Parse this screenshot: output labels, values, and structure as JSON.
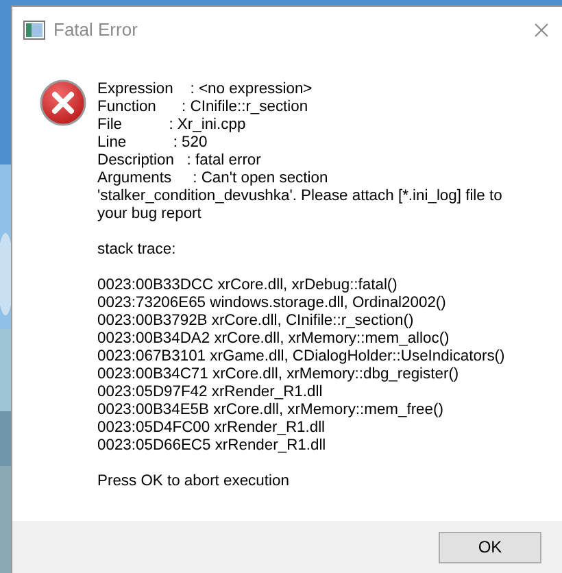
{
  "window": {
    "title": "Fatal Error"
  },
  "details": [
    "Expression    : <no expression>",
    "Function      : CInifile::r_section",
    "File           : Xr_ini.cpp",
    "Line           : 520",
    "Description   : fatal error",
    "Arguments     : Can't open section",
    "'stalker_condition_devushka'. Please attach [*.ini_log] file to",
    "your bug report"
  ],
  "stack_trace_heading": "stack trace:",
  "stack_trace": [
    "0023:00B33DCC xrCore.dll, xrDebug::fatal()",
    "0023:73206E65 windows.storage.dll, Ordinal2002()",
    "0023:00B3792B xrCore.dll, CInifile::r_section()",
    "0023:00B34DA2 xrCore.dll, xrMemory::mem_alloc()",
    "0023:067B3101 xrGame.dll, CDialogHolder::UseIndicators()",
    "0023:00B34C71 xrCore.dll, xrMemory::dbg_register()",
    "0023:05D97F42 xrRender_R1.dll",
    "0023:00B34E5B xrCore.dll, xrMemory::mem_free()",
    "0023:05D4FC00 xrRender_R1.dll",
    "0023:05D66EC5 xrRender_R1.dll"
  ],
  "prompt": "Press OK to abort execution",
  "buttons": [
    "OK"
  ]
}
